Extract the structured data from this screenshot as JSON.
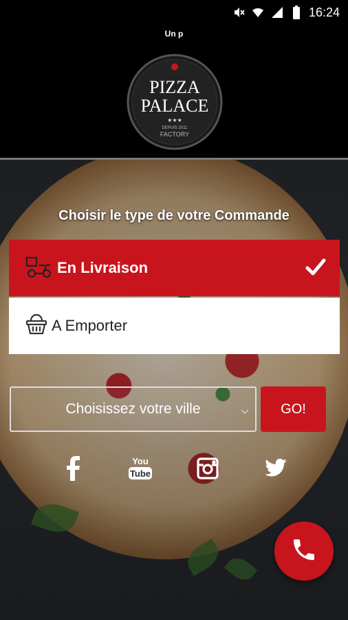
{
  "status_bar": {
    "time": "16:24",
    "icons": [
      "mute-icon",
      "wifi-icon",
      "signal-icon",
      "battery-icon"
    ]
  },
  "header": {
    "hint": "Un p",
    "logo": {
      "line1": "PIZZA",
      "line2": "PALACE",
      "tagline": "DEPUIS 2011",
      "sub": "FACTORY",
      "stars": "★★★"
    }
  },
  "order": {
    "title": "Choisir le type de votre Commande",
    "options": [
      {
        "label": "En Livraison",
        "icon": "scooter-icon",
        "selected": true
      },
      {
        "label": "A Emporter",
        "icon": "basket-icon",
        "selected": false
      }
    ]
  },
  "city_select": {
    "placeholder": "Choisissez votre ville",
    "go_label": "GO!"
  },
  "social": [
    "facebook-icon",
    "youtube-icon",
    "instagram-icon",
    "twitter-icon"
  ],
  "social_text": {
    "youtube_top": "You",
    "youtube_bottom": "Tube"
  },
  "colors": {
    "accent": "#c8151d",
    "header_bg": "#000000"
  }
}
